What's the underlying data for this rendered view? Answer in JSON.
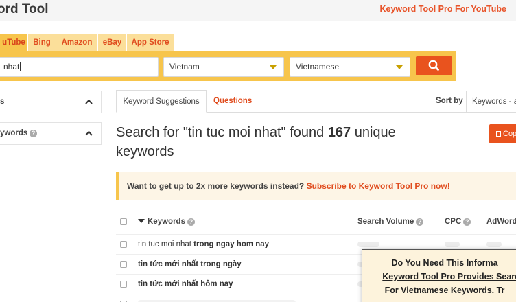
{
  "header": {
    "logo": "ord Tool",
    "pro_link": "Keyword Tool Pro For YouTube"
  },
  "tabs": [
    {
      "label": "uTube",
      "active": true
    },
    {
      "label": "Bing"
    },
    {
      "label": "Amazon"
    },
    {
      "label": "eBay"
    },
    {
      "label": "App Store"
    }
  ],
  "search": {
    "query": "nhat",
    "country": "Vietnam",
    "language": "Vietnamese"
  },
  "filters": [
    {
      "label": "s"
    },
    {
      "label": "ywords"
    }
  ],
  "results_tabs": {
    "suggestions": "Keyword Suggestions",
    "questions": "Questions"
  },
  "sort": {
    "label": "Sort by",
    "value": "Keywords - a"
  },
  "headline": {
    "prefix": "Search for \"tin tuc moi nhat\" found ",
    "count": "167",
    "suffix": " unique keywords"
  },
  "copy_label": "Cop",
  "promo": {
    "text": "Want to get up to 2x more keywords instead? ",
    "link": "Subscribe to Keyword Tool Pro now!"
  },
  "table": {
    "columns": {
      "keywords": "Keywords",
      "volume": "Search Volume",
      "cpc": "CPC",
      "adwords": "AdWords"
    },
    "rows": [
      {
        "base": "tin tuc moi nhat",
        "suffix": " trong ngay hom nay"
      },
      {
        "base": "",
        "suffix": "tin tức mới nhất trong ngày"
      },
      {
        "base": "",
        "suffix": "tin tức mới nhất hôm nay"
      }
    ]
  },
  "popup": {
    "line1": "Do You Need This Informa",
    "line2": "Keyword Tool Pro Provides Search",
    "line3": "For Vietnamese Keywords. Tr"
  },
  "colors": {
    "accent": "#e9531e",
    "band": "#f7c54c",
    "tab": "#fbdf9a"
  }
}
